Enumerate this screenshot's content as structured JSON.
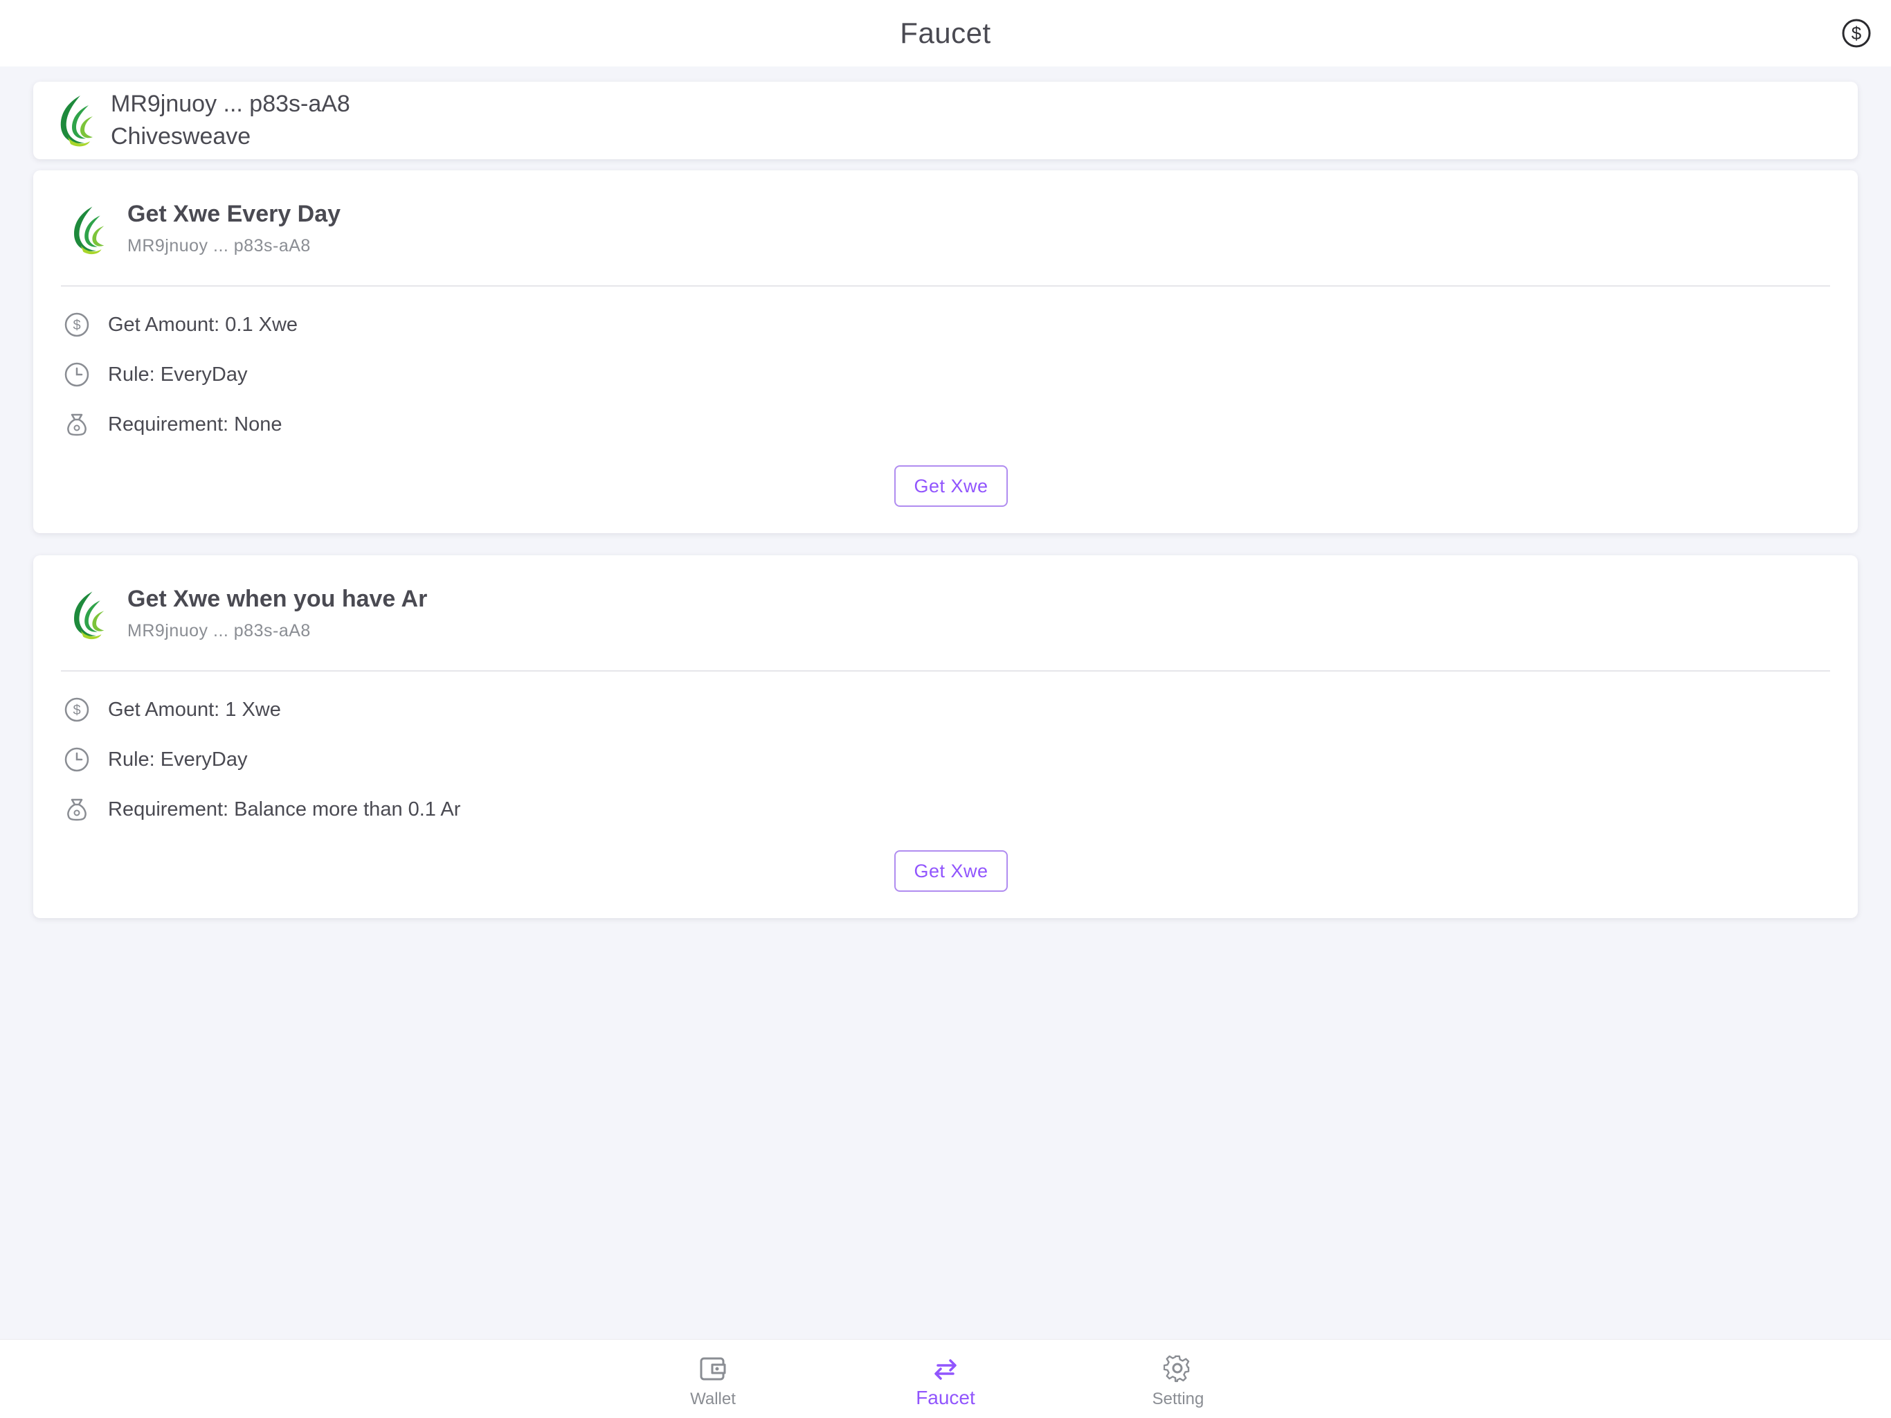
{
  "header": {
    "title": "Faucet",
    "action_icon": "dollar-circle-icon"
  },
  "account": {
    "address": "MR9jnuoy ... p83s-aA8",
    "network": "Chivesweave",
    "logo_icon": "chivesweave-logo-icon"
  },
  "faucets": [
    {
      "title": "Get Xwe Every Day",
      "address": "MR9jnuoy ... p83s-aA8",
      "amount": "Get Amount: 0.1 Xwe",
      "rule": "Rule: EveryDay",
      "requirement": "Requirement: None",
      "button_label": "Get Xwe"
    },
    {
      "title": "Get Xwe when you have Ar",
      "address": "MR9jnuoy ... p83s-aA8",
      "amount": "Get Amount: 1 Xwe",
      "rule": "Rule: EveryDay",
      "requirement": "Requirement: Balance more than 0.1 Ar",
      "button_label": "Get Xwe"
    }
  ],
  "nav": {
    "items": [
      {
        "label": "Wallet",
        "icon": "wallet-icon",
        "active": false
      },
      {
        "label": "Faucet",
        "icon": "swap-arrows-icon",
        "active": true
      },
      {
        "label": "Setting",
        "icon": "gear-icon",
        "active": false
      }
    ]
  },
  "colors": {
    "accent": "#9155fd",
    "text": "#4a4a52",
    "muted": "#8a8d93",
    "background": "#f4f5fa",
    "logo_green_dark": "#1e8a3c",
    "logo_green_light": "#a8d62b"
  }
}
